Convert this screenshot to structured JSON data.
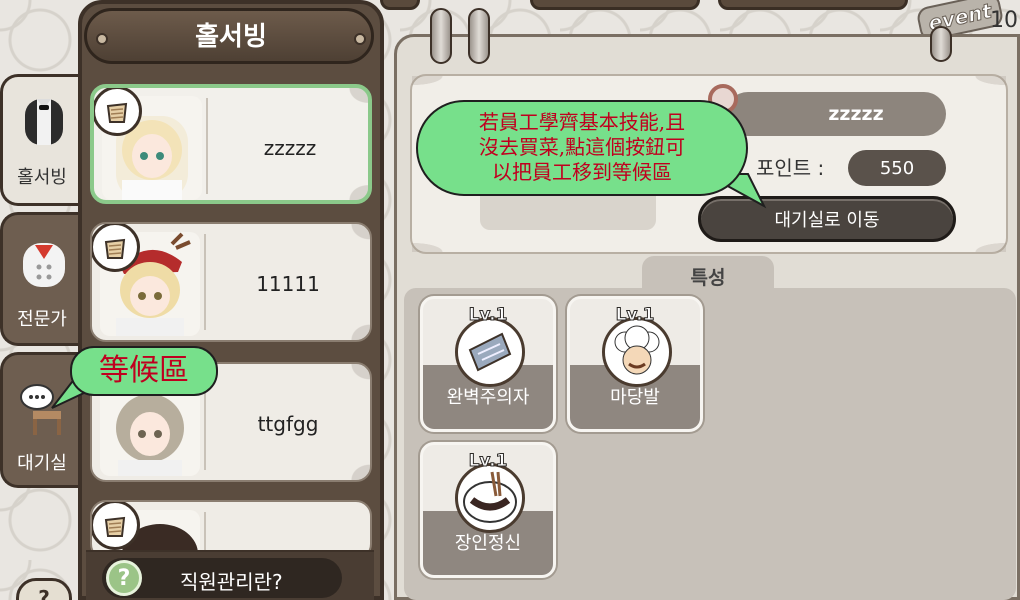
{
  "top": {
    "event_badge": "event",
    "number": "10"
  },
  "sidebar": {
    "tabs": [
      {
        "label": "홀서빙",
        "icon": "waiter-uniform-icon",
        "active": true
      },
      {
        "label": "전문가",
        "icon": "chef-uniform-icon",
        "active": false
      },
      {
        "label": "대기실",
        "icon": "waiting-chair-icon",
        "active": false
      }
    ],
    "bottom_icon_text": "?"
  },
  "staff_list": {
    "header": "홀서빙",
    "cards": [
      {
        "name": "zzzzz",
        "selected": true,
        "badge_icon": "basket-icon"
      },
      {
        "name": "11111",
        "selected": false,
        "badge_icon": "basket-icon"
      },
      {
        "name": "ttgfgg",
        "selected": false,
        "badge_icon": "basket-icon"
      },
      {
        "name": "",
        "selected": false,
        "badge_icon": "basket-icon"
      }
    ],
    "help": {
      "icon_text": "?",
      "label": "직원관리란?"
    }
  },
  "detail": {
    "employee_name": "zzzzz",
    "points_label": "포인트 :",
    "points_value": "550",
    "move_button": "대기실로 이동",
    "traits_tab": "특성",
    "traits": [
      {
        "level": "Lv.1",
        "name": "완벽주의자",
        "icon": "cleaver-icon"
      },
      {
        "level": "Lv.1",
        "name": "마당발",
        "icon": "chefs-icon"
      },
      {
        "level": "Lv.1",
        "name": "장인정신",
        "icon": "noodle-bowl-icon"
      }
    ]
  },
  "annotations": {
    "move_hint": [
      "若員工學齊基本技能,且",
      "沒去買菜,點這個按鈕可",
      "以把員工移到等候區"
    ],
    "waiting_label": "等候區"
  },
  "colors": {
    "frame_brown": "#5c4d40",
    "selected_border": "#8bc98a",
    "callout_green": "#77e08b",
    "callout_text": "#c0001f"
  }
}
